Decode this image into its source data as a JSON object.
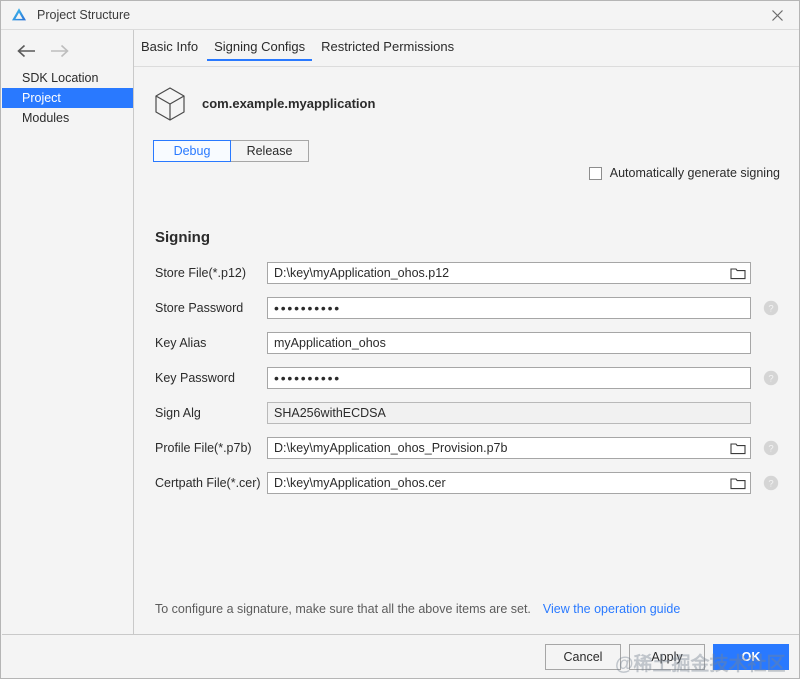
{
  "window": {
    "title": "Project Structure",
    "logo_icon": "deveco-logo-icon",
    "close_icon": "close-icon"
  },
  "sidebar": {
    "back_icon": "arrow-left-icon",
    "forward_icon": "arrow-right-icon",
    "items": [
      {
        "label": "SDK Location",
        "selected": false
      },
      {
        "label": "Project",
        "selected": true
      },
      {
        "label": "Modules",
        "selected": false
      }
    ]
  },
  "main": {
    "tabs": [
      {
        "label": "Basic Info",
        "active": false
      },
      {
        "label": "Signing Configs",
        "active": true
      },
      {
        "label": "Restricted Permissions",
        "active": false
      }
    ],
    "package": {
      "icon": "package-cube-icon",
      "name": "com.example.myapplication"
    },
    "build_variants": [
      {
        "label": "Debug",
        "active": true
      },
      {
        "label": "Release",
        "active": false
      }
    ],
    "auto_generate": {
      "label": "Automatically generate signing",
      "checked": false
    },
    "section_title": "Signing",
    "fields": [
      {
        "label": "Store File(*.p12)",
        "value": "D:\\key\\myApplication_ohos.p12",
        "masked": false,
        "readonly": false,
        "wide": true,
        "browse": true,
        "help": false
      },
      {
        "label": "Store Password",
        "value": "••••••••••",
        "masked": true,
        "readonly": false,
        "wide": true,
        "browse": false,
        "help": true
      },
      {
        "label": "Key Alias",
        "value": "myApplication_ohos",
        "masked": false,
        "readonly": false,
        "wide": true,
        "browse": false,
        "help": false
      },
      {
        "label": "Key Password",
        "value": "••••••••••",
        "masked": true,
        "readonly": false,
        "wide": true,
        "browse": false,
        "help": true
      },
      {
        "label": "Sign Alg",
        "value": "SHA256withECDSA",
        "masked": false,
        "readonly": true,
        "wide": true,
        "browse": false,
        "help": false
      },
      {
        "label": "Profile File(*.p7b)",
        "value": "D:\\key\\myApplication_ohos_Provision.p7b",
        "masked": false,
        "readonly": false,
        "wide": true,
        "browse": true,
        "help": true
      },
      {
        "label": "Certpath File(*.cer)",
        "value": "D:\\key\\myApplication_ohos.cer",
        "masked": false,
        "readonly": false,
        "wide": true,
        "browse": true,
        "help": true
      }
    ],
    "hint": {
      "text": "To configure a signature, make sure that all the above items are set.",
      "link": "View the operation guide"
    }
  },
  "footer": {
    "buttons": [
      {
        "label": "Cancel",
        "primary": false
      },
      {
        "label": "Apply",
        "primary": false
      },
      {
        "label": "OK",
        "primary": true
      }
    ]
  },
  "watermark": {
    "text": "@稀土掘金技术社区"
  },
  "colors": {
    "accent": "#2979ff",
    "window_bg": "#f4f4f4",
    "field_bg": "#ffffff",
    "readonly_bg": "#f1f1f1",
    "border": "#a6a6a6",
    "text": "#2b2b2b",
    "muted_text": "#5c5c5c"
  }
}
